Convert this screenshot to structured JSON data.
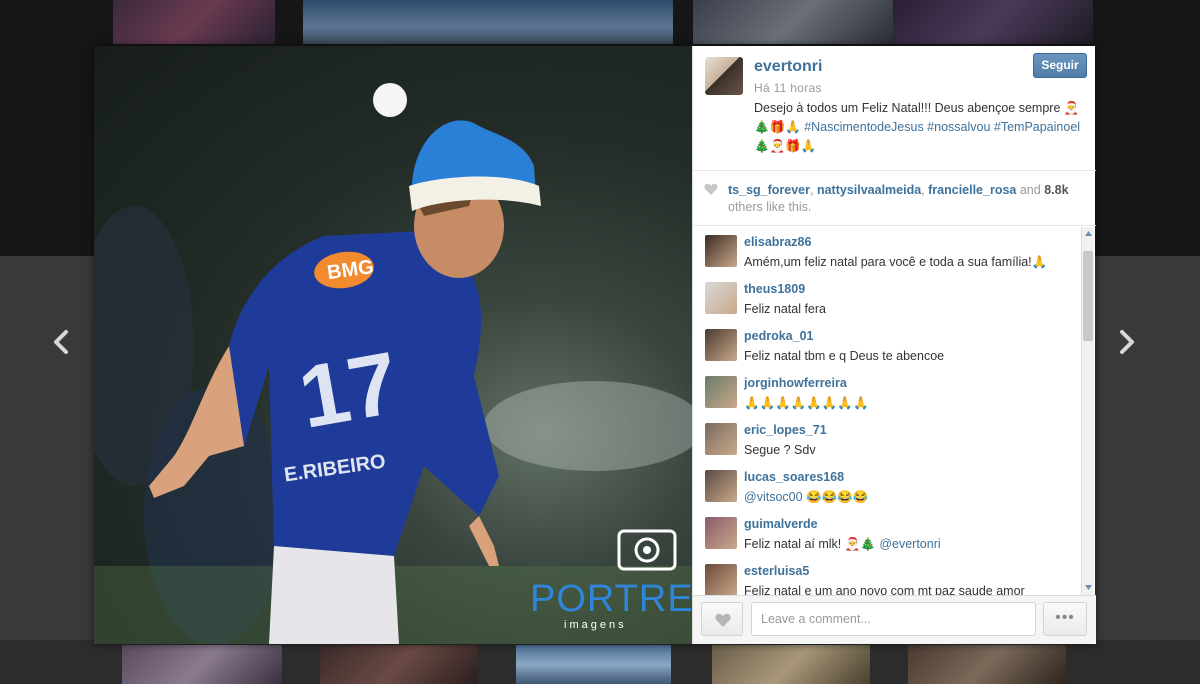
{
  "post": {
    "owner": "evertonri",
    "time": "Há 11 horas",
    "follow_label": "Seguir",
    "caption_text": "Desejo à todos um Feliz Natal!!! Deus abençoe sempre ",
    "caption_emoji_1": "🎅🎄🎁🙏",
    "caption_hashtags": "#NascimentodeJesus #nossalvou #TemPapainoel",
    "caption_emoji_2": "🎄🎅🎁🙏",
    "watermark_brand": "PORTRE",
    "watermark_sub": "imagens",
    "jersey_sponsor": "BMG",
    "jersey_number": "17",
    "jersey_name": "E.RIBEIRO"
  },
  "likes": {
    "user1": "ts_sg_forever",
    "user2": "nattysilvaalmeida",
    "user3": "francielle_rosa",
    "and": " and",
    "count": "8.8k",
    "tail": " others like this."
  },
  "comments": [
    {
      "user": "elisabraz86",
      "text": "Amém,um feliz natal para você e toda a sua família!🙏",
      "avatar_color": "#3b2a24"
    },
    {
      "user": "theus1809",
      "text": "Feliz natal fera",
      "avatar_color": "#d8d8d8"
    },
    {
      "user": "pedroka_01",
      "text": "Feliz natal tbm e q Deus te abencoe",
      "avatar_color": "#4a3a33"
    },
    {
      "user": "jorginhowferreira",
      "text": "🙏🙏🙏🙏🙏🙏🙏🙏",
      "avatar_color": "#6a7a6a"
    },
    {
      "user": "eric_lopes_71",
      "text": "Segue ? Sdv",
      "avatar_color": "#7a6a60"
    },
    {
      "user": "lucas_soares168",
      "mention": "@vitsoc00",
      "text": " 😂😂😂😂",
      "avatar_color": "#5a4a44"
    },
    {
      "user": "guimalverde",
      "text": "Feliz natal aí mlk! 🎅🎄 ",
      "mention": "@evertonri",
      "avatar_color": "#8a5a6a"
    },
    {
      "user": "esterluisa5",
      "text": "Feliz natal e um ano novo com mt paz saude amor",
      "avatar_color": "#6a4a3a"
    }
  ],
  "footer": {
    "comment_placeholder": "Leave a comment...",
    "more_label": "•••"
  },
  "colors": {
    "link": "#3f729b",
    "follow_button": "#4f7ea8",
    "santa_hat": "#2a7fd6"
  },
  "icons": {
    "prev": "chevron-left-icon",
    "next": "chevron-right-icon",
    "heart": "heart-icon",
    "camera": "camera-icon"
  }
}
